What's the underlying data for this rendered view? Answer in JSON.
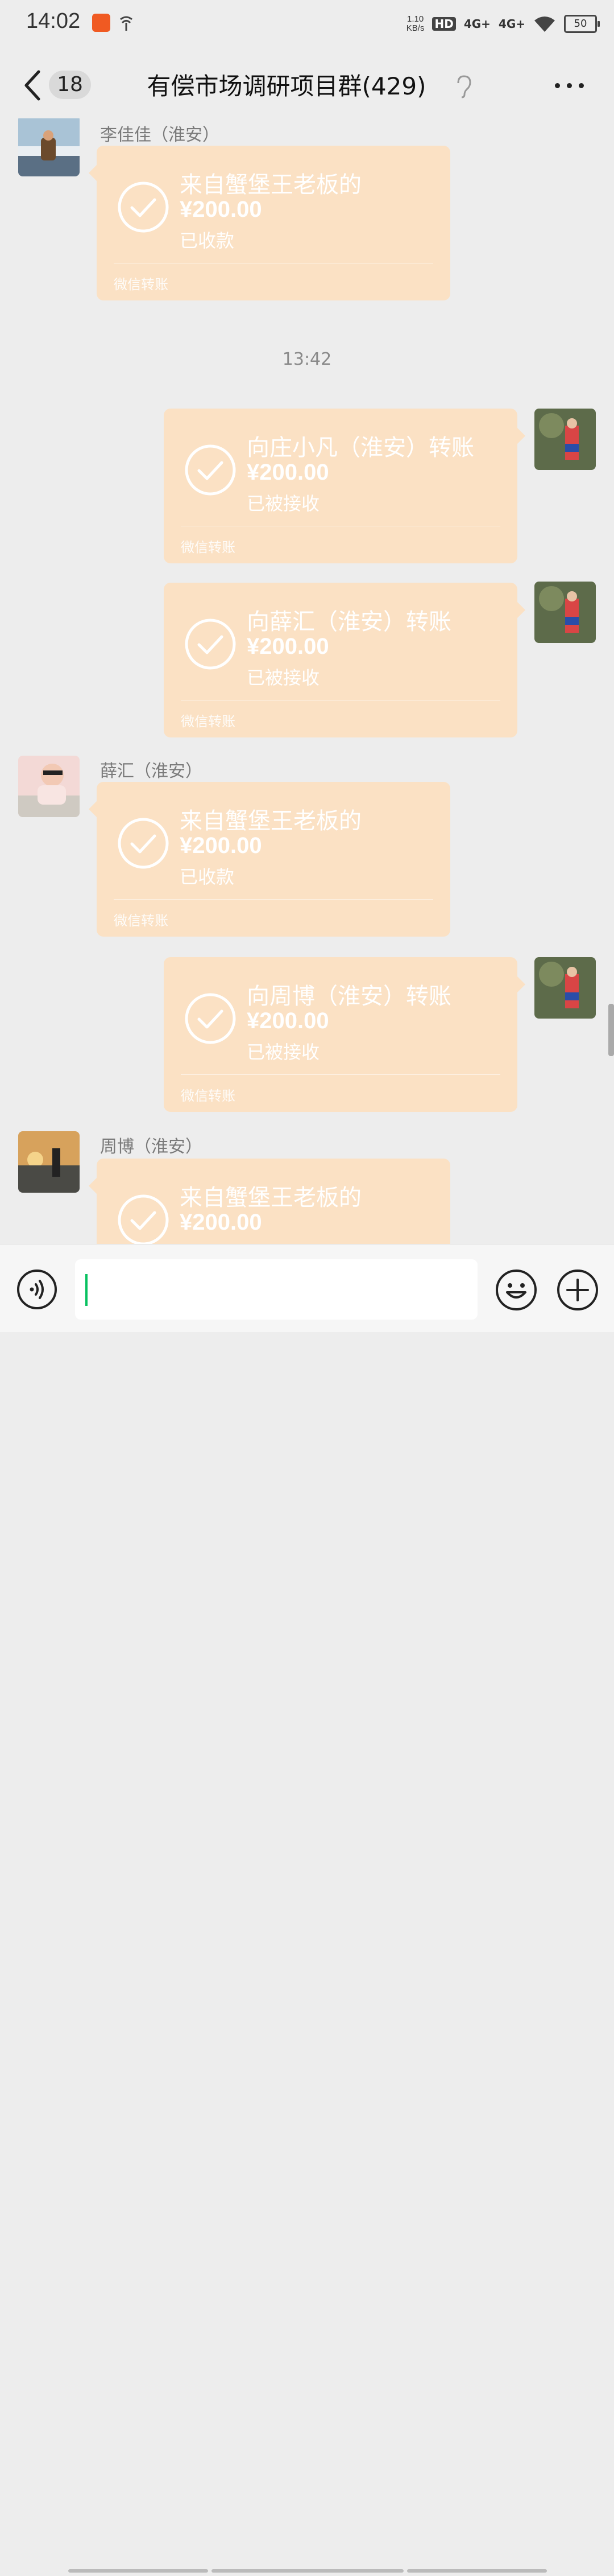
{
  "status_bar": {
    "time": "14:02",
    "speed_value": "1.10",
    "speed_unit": "KB/s",
    "hd": "HD",
    "net1": "4G+",
    "net2": "4G+",
    "battery": "50"
  },
  "header": {
    "unread_count": "18",
    "title": "有偿市场调研项目群(429)"
  },
  "chat": {
    "timestamp": "13:42",
    "messages": [
      {
        "sender": "李佳佳（淮安）",
        "title": "来自蟹堡王老板的",
        "amount": "¥200.00",
        "status": "已收款",
        "footer": "微信转账"
      },
      {
        "title": "向庄小凡（淮安）转账",
        "amount": "¥200.00",
        "status": "已被接收",
        "footer": "微信转账"
      },
      {
        "title": "向薛汇（淮安）转账",
        "amount": "¥200.00",
        "status": "已被接收",
        "footer": "微信转账"
      },
      {
        "sender": "薛汇（淮安）",
        "title": "来自蟹堡王老板的",
        "amount": "¥200.00",
        "status": "已收款",
        "footer": "微信转账"
      },
      {
        "title": "向周博（淮安）转账",
        "amount": "¥200.00",
        "status": "已被接收",
        "footer": "微信转账"
      },
      {
        "sender": "周博（淮安）",
        "title": "来自蟹堡王老板的",
        "amount": "¥200.00",
        "status": "",
        "footer": ""
      }
    ]
  },
  "input": {
    "value": ""
  },
  "colors": {
    "bubble": "#fbe1c4",
    "background": "#ededed",
    "cursor": "#07c160"
  }
}
